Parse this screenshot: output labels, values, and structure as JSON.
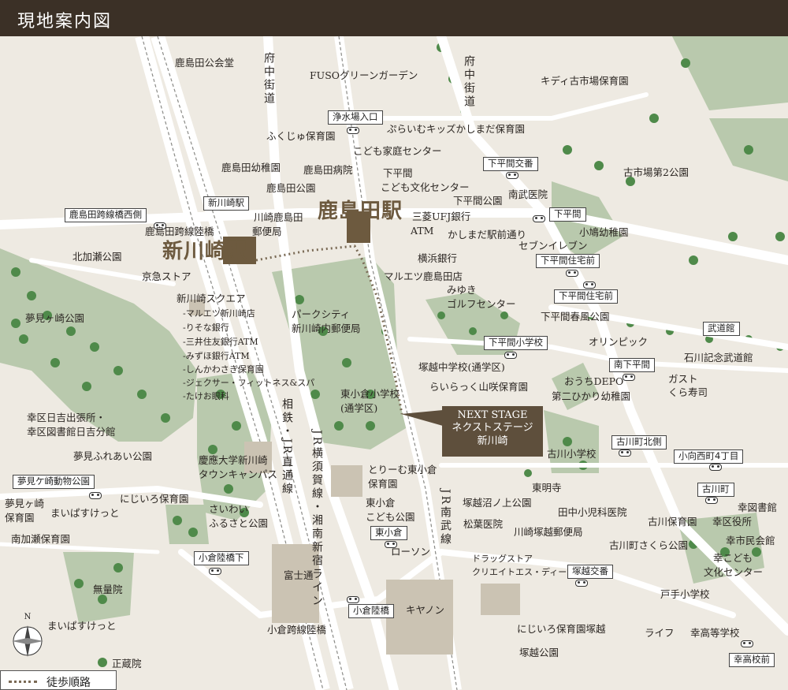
{
  "header": {
    "title": "現地案内図"
  },
  "stations": {
    "kashimada": "鹿島田駅",
    "shinkawasaki": "新川崎駅"
  },
  "property": {
    "line1": "NEXT STAGE",
    "line2": "ネクストステージ",
    "line3": "新川崎"
  },
  "legend": {
    "label": "徒歩順路"
  },
  "compass": {
    "north": "N"
  },
  "roads": {
    "fuchu_kaido_1": "府中街道",
    "fuchu_kaido_2": "府中街道",
    "sotetsu_jr": "相鉄・JR直通線",
    "jr_yokosuka": "JR横須賀線・湘南新宿ライン",
    "jr_nambu": "JR南武線"
  },
  "bus_stops": [
    "浄水場入口",
    "下平間交番",
    "新川崎駅",
    "鹿島田跨線橋西側",
    "下平間",
    "下平間住宅前",
    "下平間住宅前",
    "武道館",
    "下平間小学校",
    "南下平間",
    "古川町北側",
    "小向西町4丁目",
    "古川町",
    "夢見ケ崎動物公園",
    "東小倉",
    "塚越交番",
    "小倉陸橋下",
    "小倉陸橋",
    "幸高校前"
  ],
  "labels": [
    "鹿島田公会堂",
    "FUSOグリーンガーデン",
    "キディ古市場保育園",
    "ぷらいむキッズかしまだ保育園",
    "ふくじゅ保育園",
    "こども家庭センター",
    "鹿島田幼稚園",
    "鹿島田病院",
    "下平間",
    "こども文化センター",
    "鹿島田公園",
    "下平間公園",
    "南武医院",
    "古市場第2公園",
    "川崎鹿島田",
    "郵便局",
    "三菱UFJ銀行",
    "ATM",
    "かしまだ駅前通り",
    "セブンイレブン",
    "小鳩幼稚園",
    "鹿島田跨線陸橋",
    "北加瀬公園",
    "京急ストア",
    "横浜銀行",
    "マルエツ鹿島田店",
    "みゆき",
    "ゴルフセンター",
    "新川崎スクエア",
    "-マルエツ新川崎店",
    "-りそな銀行",
    "-三井住友銀行ATM",
    "-みずほ銀行ATM",
    "-しんかわさき保育園",
    "-ジェクサー・フィットネス&スパ",
    "-たけお眼科",
    "夢見ヶ崎公園",
    "パークシティ",
    "新川崎内郵便局",
    "下平間春風公園",
    "オリンピック",
    "石川記念武道館",
    "塚越中学校(通学区)",
    "らいらっく山咲保育園",
    "おうちDEPO",
    "第二ひかり幼稚園",
    "ガスト",
    "くら寿司",
    "東小倉小学校",
    "(通学区)",
    "幸区日吉出張所・",
    "幸区図書館日吉分館",
    "古川小学校",
    "夢見ふれあい公園",
    "慶應大学新川崎",
    "タウンキャンパス",
    "とりーむ東小倉",
    "保育園",
    "東明寺",
    "塚越沼ノ上公園",
    "田中小児科医院",
    "古川保育園",
    "幸区役所",
    "幸図書館",
    "夢見ヶ崎",
    "保育園",
    "まいぱすけっと",
    "にじいろ保育園",
    "さいわい",
    "ふるさと公園",
    "東小倉",
    "こども公園",
    "松葉医院",
    "川崎塚越郵便局",
    "古川町さくら公園",
    "幸市民会館",
    "南加瀬保育園",
    "ローソン",
    "富士通",
    "ドラッグストア",
    "クリエイトエス・ディー",
    "幸こども",
    "文化センター",
    "無量院",
    "キヤノン",
    "戸手小学校",
    "まいぱすけっと",
    "小倉跨線陸橋",
    "にじいろ保育園塚越",
    "ライフ",
    "幸高等学校",
    "塚越公園",
    "正蔵院"
  ]
}
